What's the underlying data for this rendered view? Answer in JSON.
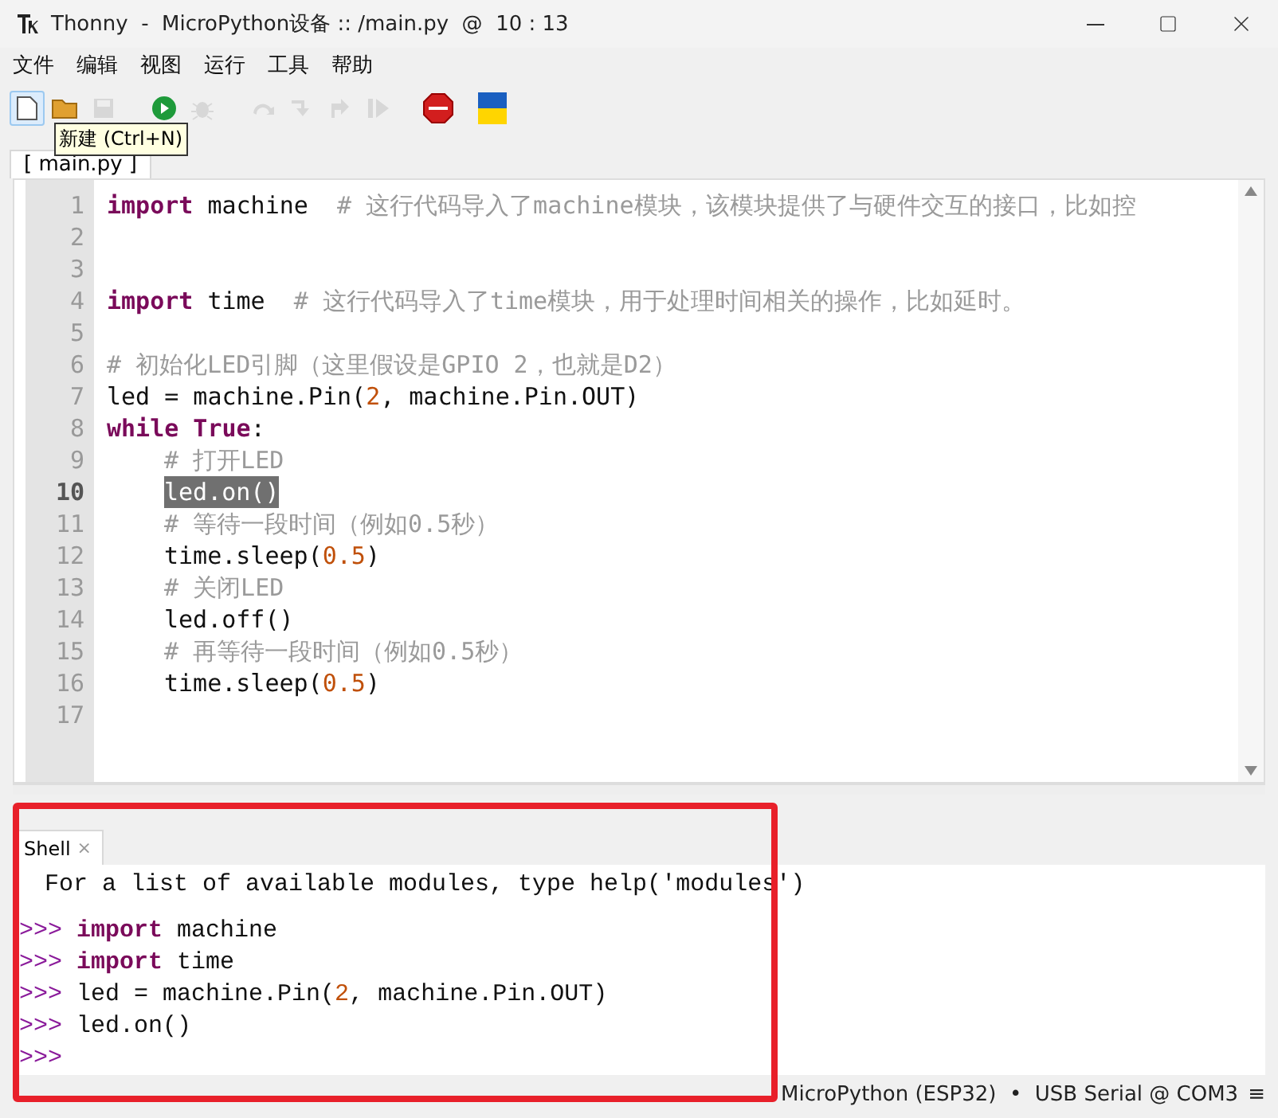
{
  "window": {
    "title": "Thonny  -  MicroPython设备 :: /main.py  @  10 : 13"
  },
  "menu": [
    "文件",
    "编辑",
    "视图",
    "运行",
    "工具",
    "帮助"
  ],
  "toolbar": [
    {
      "kind": "new",
      "disabled": false,
      "selected": true
    },
    {
      "kind": "open",
      "disabled": false,
      "selected": false
    },
    {
      "kind": "save",
      "disabled": true,
      "selected": false
    },
    {
      "kind": "run",
      "disabled": false,
      "selected": false
    },
    {
      "kind": "debug",
      "disabled": true,
      "selected": false
    },
    {
      "kind": "step-over",
      "disabled": true,
      "selected": false
    },
    {
      "kind": "step-into",
      "disabled": true,
      "selected": false
    },
    {
      "kind": "step-out",
      "disabled": true,
      "selected": false
    },
    {
      "kind": "resume",
      "disabled": true,
      "selected": false
    },
    {
      "kind": "stop",
      "disabled": false,
      "selected": false
    },
    {
      "kind": "flag",
      "disabled": false,
      "selected": false
    }
  ],
  "tooltip": "新建 (Ctrl+N)",
  "editor": {
    "tabs": [
      {
        "label": "[ main.py ]",
        "selected": true
      }
    ],
    "lines": [
      {
        "number": "1",
        "current": false,
        "indent": false,
        "tokens": [
          {
            "kind": "keyword",
            "text": "import"
          },
          {
            "kind": "plain",
            "text": " machine  "
          },
          {
            "kind": "comment",
            "text": "# 这行代码导入了machine模块，该模块提供了与硬件交互的接口，比如控"
          }
        ]
      },
      {
        "number": "2",
        "current": false
      },
      {
        "number": "3",
        "current": false
      },
      {
        "number": "4",
        "current": false,
        "indent": false,
        "tokens": [
          {
            "kind": "keyword",
            "text": "import"
          },
          {
            "kind": "plain",
            "text": " time  "
          },
          {
            "kind": "comment",
            "text": "# 这行代码导入了time模块，用于处理时间相关的操作，比如延时。"
          }
        ]
      },
      {
        "number": "5",
        "current": false
      },
      {
        "number": "6",
        "current": false,
        "indent": false,
        "tokens": [
          {
            "kind": "comment",
            "text": "# 初始化LED引脚（这里假设是GPIO 2，也就是D2）"
          }
        ]
      },
      {
        "number": "7",
        "current": false,
        "indent": false,
        "tokens": [
          {
            "kind": "plain",
            "text": "led = machine.Pin("
          },
          {
            "kind": "number",
            "text": "2"
          },
          {
            "kind": "plain",
            "text": ", machine.Pin.OUT)"
          }
        ]
      },
      {
        "number": "8",
        "current": false,
        "indent": false,
        "tokens": [
          {
            "kind": "keyword",
            "text": "while True"
          },
          {
            "kind": "plain",
            "text": ":"
          }
        ]
      },
      {
        "number": "9",
        "current": false,
        "indent": true,
        "tokens": [
          {
            "kind": "comment",
            "text": "# 打开LED"
          }
        ]
      },
      {
        "number": "10",
        "current": true,
        "indent": true,
        "tokens": [
          {
            "kind": "selection",
            "text": "led.on()"
          }
        ]
      },
      {
        "number": "11",
        "current": false,
        "indent": true,
        "tokens": [
          {
            "kind": "comment",
            "text": "# 等待一段时间（例如0.5秒）"
          }
        ]
      },
      {
        "number": "12",
        "current": false,
        "indent": true,
        "tokens": [
          {
            "kind": "plain",
            "text": "time.sleep("
          },
          {
            "kind": "number",
            "text": "0.5"
          },
          {
            "kind": "plain",
            "text": ")"
          }
        ]
      },
      {
        "number": "13",
        "current": false,
        "indent": true,
        "tokens": [
          {
            "kind": "comment",
            "text": "# 关闭LED"
          }
        ]
      },
      {
        "number": "14",
        "current": false,
        "indent": true,
        "tokens": [
          {
            "kind": "plain",
            "text": "led.off()"
          }
        ]
      },
      {
        "number": "15",
        "current": false,
        "indent": true,
        "tokens": [
          {
            "kind": "comment",
            "text": "# 再等待一段时间（例如0.5秒）"
          }
        ]
      },
      {
        "number": "16",
        "current": false,
        "indent": true,
        "tokens": [
          {
            "kind": "plain",
            "text": "time.sleep("
          },
          {
            "kind": "number",
            "text": "0.5"
          },
          {
            "kind": "plain",
            "text": ")"
          }
        ]
      },
      {
        "number": "17",
        "current": false
      }
    ]
  },
  "shell": {
    "tab": {
      "label": "Shell",
      "close": "×",
      "selected": true
    },
    "lines": [
      {
        "kind": "output",
        "tokens": [
          {
            "kind": "plain",
            "text": "For a list of available modules, type help('modules')"
          }
        ]
      },
      {
        "kind": "blank"
      },
      {
        "kind": "input",
        "prompt": ">>>",
        "tokens": [
          {
            "kind": "keyword",
            "text": "import"
          },
          {
            "kind": "plain",
            "text": " machine"
          }
        ]
      },
      {
        "kind": "input",
        "prompt": ">>>",
        "tokens": [
          {
            "kind": "keyword",
            "text": "import"
          },
          {
            "kind": "plain",
            "text": " time"
          }
        ]
      },
      {
        "kind": "input",
        "prompt": ">>>",
        "tokens": [
          {
            "kind": "plain",
            "text": "led = machine.Pin("
          },
          {
            "kind": "number",
            "text": "2"
          },
          {
            "kind": "plain",
            "text": ", machine.Pin.OUT)"
          }
        ]
      },
      {
        "kind": "input",
        "prompt": ">>>",
        "tokens": [
          {
            "kind": "plain",
            "text": "led.on()"
          }
        ]
      },
      {
        "kind": "input",
        "prompt": ">>>"
      }
    ]
  },
  "status_bar": {
    "interpreter": "MicroPython (ESP32)  •  USB Serial @ COM3",
    "menu": "≡"
  }
}
